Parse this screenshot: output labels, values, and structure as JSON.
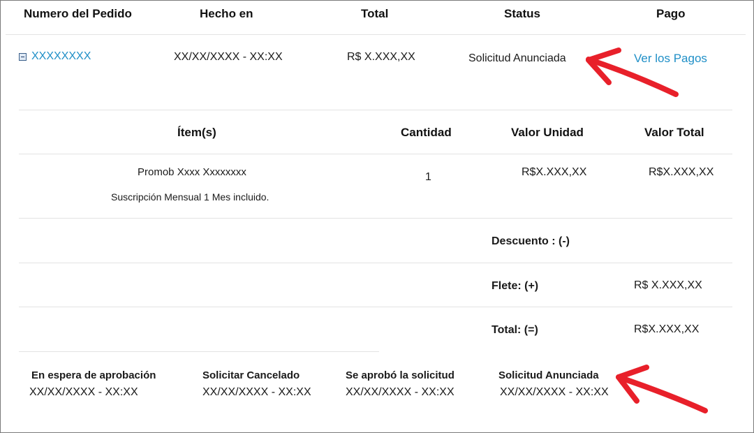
{
  "order_header": {
    "col_order": "Numero del Pedido",
    "col_date": "Hecho en",
    "col_total": "Total",
    "col_status": "Status",
    "col_payment": "Pago"
  },
  "order_row": {
    "order_number": "XXXXXXXX",
    "date": "XX/XX/XXXX - XX:XX",
    "total": "R$ X.XXX,XX",
    "status": "Solicitud Anunciada",
    "payment_link": "Ver los Pagos"
  },
  "items_header": {
    "col_items": "Ítem(s)",
    "col_quantity": "Cantidad",
    "col_unit_value": "Valor Unidad",
    "col_total_value": "Valor Total"
  },
  "item": {
    "name": "Promob Xxxx Xxxxxxxx",
    "description": "Suscripción Mensual 1 Mes incluido.",
    "quantity": "1",
    "unit_value": "R$X.XXX,XX",
    "total_value": "R$X.XXX,XX"
  },
  "summary": {
    "discount_label": "Descuento : (-)",
    "shipping_label": "Flete: (+)",
    "shipping_value": "R$ X.XXX,XX",
    "total_label": "Total: (=)",
    "total_value": "R$X.XXX,XX"
  },
  "timeline": [
    {
      "label": "En espera de aprobación",
      "date": "XX/XX/XXXX - XX:XX"
    },
    {
      "label": "Solicitar Cancelado",
      "date": "XX/XX/XXXX - XX:XX"
    },
    {
      "label": "Se aprobó la solicitud",
      "date": "XX/XX/XXXX - XX:XX"
    },
    {
      "label": "Solicitud Anunciada",
      "date": "XX/XX/XXXX - XX:XX"
    }
  ],
  "colors": {
    "link": "#1f8fc7",
    "annotation_arrow": "#e8202a"
  }
}
